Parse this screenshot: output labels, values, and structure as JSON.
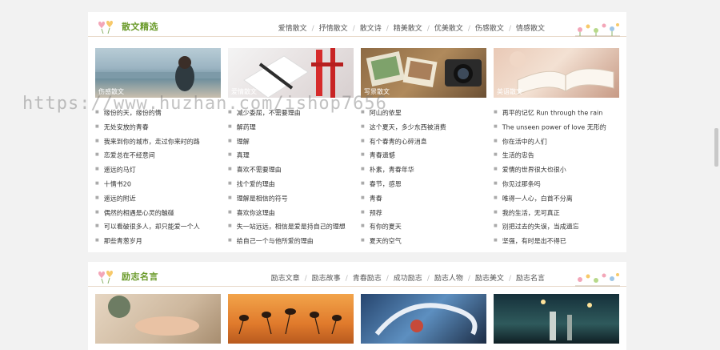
{
  "section1": {
    "title": "散文精选",
    "tabs": [
      "爱情散文",
      "抒情散文",
      "散文诗",
      "精美散文",
      "优美散文",
      "伤感散文",
      "情感散文"
    ],
    "cards": [
      {
        "label": "伤感散文",
        "theme": "seaside"
      },
      {
        "label": "爱情散文",
        "theme": "gift"
      },
      {
        "label": "写景散文",
        "theme": "camera"
      },
      {
        "label": "英语散文",
        "theme": "book"
      }
    ],
    "columns": [
      [
        "缘份的天，缘份的情",
        "无处安放的青春",
        "我来到你的城市，走过你来时的路",
        "恋爱总在不经意间",
        "遥远的马灯",
        "十情书20",
        "遥远的附近",
        "偶然的相遇是心灵的触碰",
        "可以看破很多人，却只能爱一个人",
        "那些青葱岁月"
      ],
      [
        "减少委屈，不需要理由",
        "解药理",
        "理解",
        "真理",
        "喜欢不需要理由",
        "找个爱的理由",
        "理解是相信的符号",
        "喜欢你这理由",
        "失一站远远，相信是爱是持自己的理想",
        "给自己一个与他所爱的理由"
      ],
      [
        "阿山的依里",
        "这个夏天，多少东西被消费",
        "有个春青的心碎消息",
        "青春遗憾",
        "朴素，青春年华",
        "春节，感恩",
        "青春",
        "预荐",
        "有你的夏天",
        "夏天的空气"
      ],
      [
        "再平的记忆 Run through the rain",
        "The unseen power of love 无形的",
        "你在活中的人们",
        "生活的忠告",
        "爱情的世界很大也很小",
        "你见过那条吗",
        "唯得一人心，白首不分离",
        "我的生活，无可真正",
        "别把过去的失误，当成遗忘",
        "坚强，有时是出不得已"
      ]
    ]
  },
  "section2": {
    "title": "励志名言",
    "tabs": [
      "励志文章",
      "励志故事",
      "青春励志",
      "成功励志",
      "励志人物",
      "励志美文",
      "励志名言"
    ]
  },
  "watermark": "https://www.huzhan.com/ishop7656"
}
